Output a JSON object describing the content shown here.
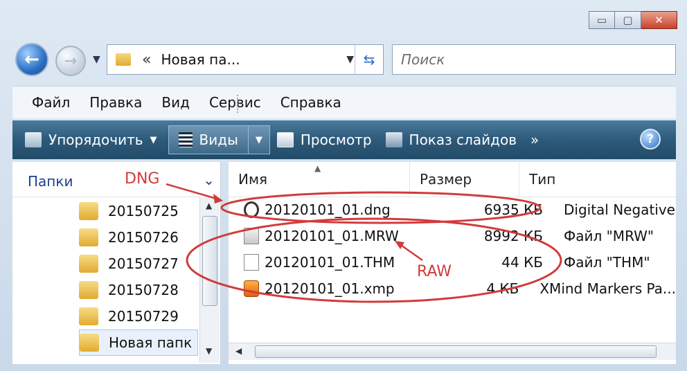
{
  "window": {
    "controls": {
      "minimize": "▭",
      "maximize": "▢",
      "close": "✕"
    }
  },
  "navigation": {
    "address_chevron": "«",
    "address_path": "Новая па...",
    "search_placeholder": "Поиск"
  },
  "menu": [
    "Файл",
    "Правка",
    "Вид",
    "Сервис",
    "Справка"
  ],
  "toolbar": {
    "organize": "Упорядочить",
    "views": "Виды",
    "preview": "Просмотр",
    "slideshow": "Показ слайдов",
    "more": "»",
    "help": "?"
  },
  "folders_pane": {
    "title": "Папки",
    "items": [
      "20150725",
      "20150726",
      "20150727",
      "20150728",
      "20150729",
      "Новая папк"
    ]
  },
  "file_list": {
    "columns": [
      "Имя",
      "Размер",
      "Тип"
    ],
    "rows": [
      {
        "name": "20120101_01.dng",
        "size": "6935 КБ",
        "type": "Digital Negative"
      },
      {
        "name": "20120101_01.MRW",
        "size": "8992 КБ",
        "type": "Файл \"MRW\""
      },
      {
        "name": "20120101_01.THM",
        "size": "44 КБ",
        "type": "Файл \"THM\""
      },
      {
        "name": "20120101_01.xmp",
        "size": "4 КБ",
        "type": "XMind Markers Pa..."
      }
    ]
  },
  "annotations": {
    "dng": "DNG",
    "raw": "RAW",
    "color": "#d23a3a"
  },
  "icons": {
    "dng": "dng-file-icon",
    "mrw": "mrw-file-icon",
    "thm": "thm-file-icon",
    "xmp": "xmp-file-icon"
  }
}
